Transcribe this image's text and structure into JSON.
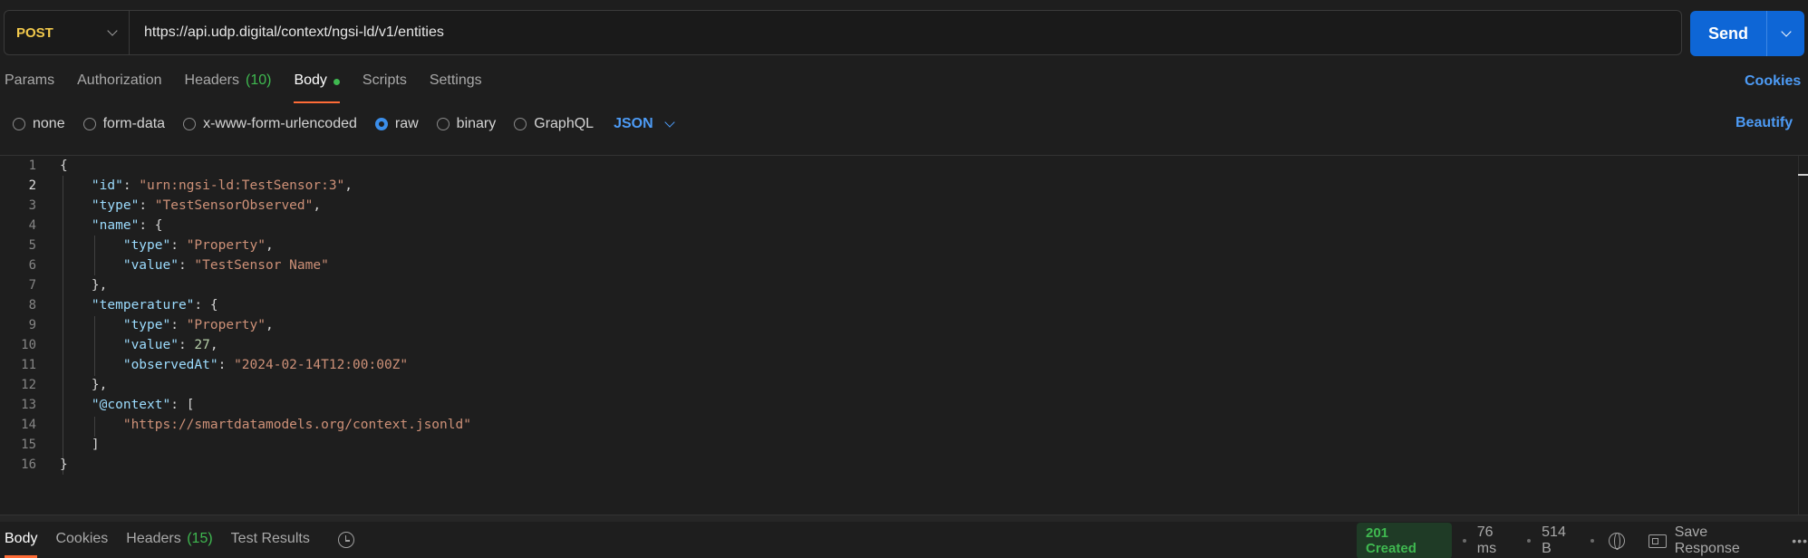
{
  "request": {
    "method": "POST",
    "url": "https://api.udp.digital/context/ngsi-ld/v1/entities",
    "send_label": "Send"
  },
  "tabs": {
    "params": "Params",
    "authorization": "Authorization",
    "headers": "Headers",
    "headers_count": "(10)",
    "body": "Body",
    "scripts": "Scripts",
    "settings": "Settings",
    "cookies": "Cookies"
  },
  "body_types": {
    "none": "none",
    "form_data": "form-data",
    "urlencoded": "x-www-form-urlencoded",
    "raw": "raw",
    "binary": "binary",
    "graphql": "GraphQL",
    "language": "JSON",
    "beautify": "Beautify",
    "selected": "raw"
  },
  "editor": {
    "line_numbers": [
      "1",
      "2",
      "3",
      "4",
      "5",
      "6",
      "7",
      "8",
      "9",
      "10",
      "11",
      "12",
      "13",
      "14",
      "15",
      "16"
    ],
    "current_line": 2,
    "tokens": {
      "open": "{",
      "close": "}",
      "id_key": "\"id\"",
      "id_val": "\"urn:ngsi-ld:TestSensor:3\"",
      "type_key": "\"type\"",
      "type_val": "\"TestSensorObserved\"",
      "name_key": "\"name\"",
      "prop_val": "\"Property\"",
      "value_key": "\"value\"",
      "name_value_val": "\"TestSensor Name\"",
      "temp_key": "\"temperature\"",
      "temp_value": "27",
      "observed_key": "\"observedAt\"",
      "observed_val": "\"2024-02-14T12:00:00Z\"",
      "context_key": "\"@context\"",
      "context_url": "\"https://smartdatamodels.org/context.jsonld\""
    }
  },
  "response": {
    "tabs": {
      "body": "Body",
      "cookies": "Cookies",
      "headers": "Headers",
      "headers_count": "(15)",
      "test_results": "Test Results"
    },
    "status": "201 Created",
    "time": "76 ms",
    "size": "514 B",
    "save_label": "Save Response",
    "more": "•••"
  },
  "colors": {
    "method": "#f2c94c",
    "send": "#0e66d6",
    "accent_tab": "#ff6c37",
    "link": "#4d9bf5",
    "success": "#3fb950"
  }
}
